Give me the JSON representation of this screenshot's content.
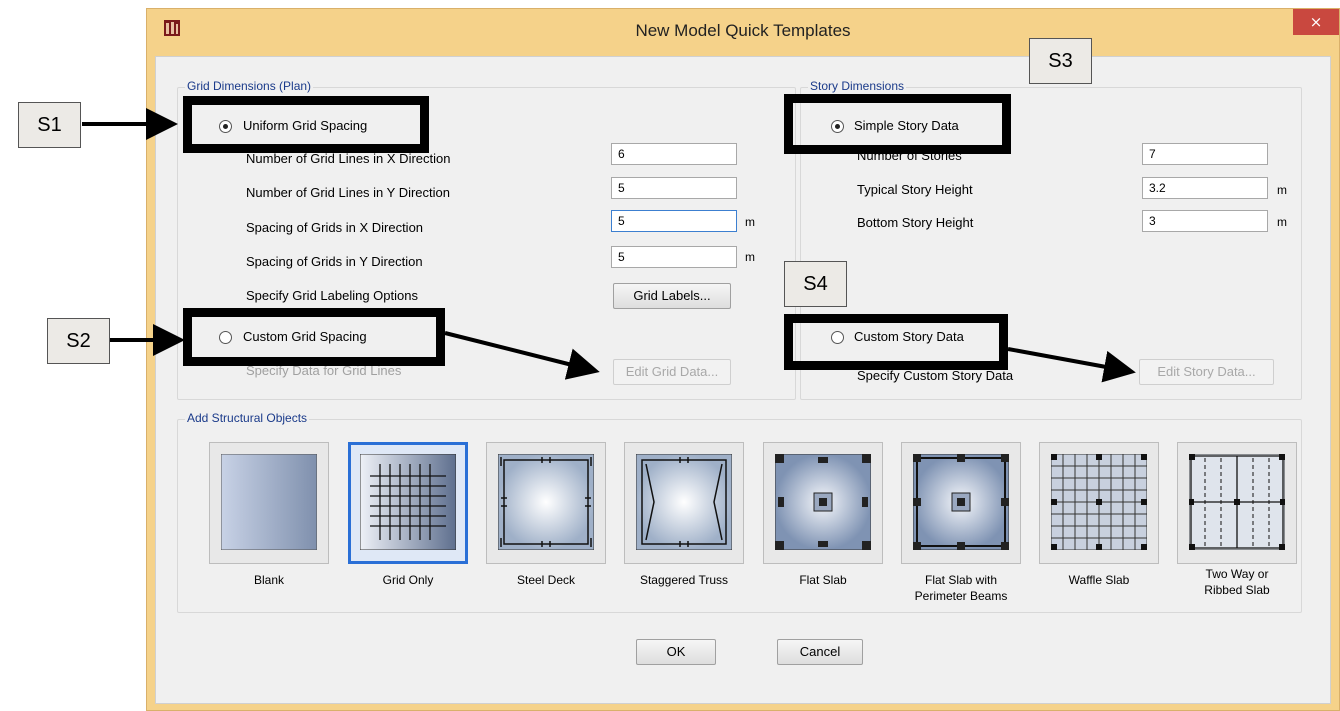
{
  "window": {
    "title": "New Model Quick Templates",
    "close_glyph": "×",
    "frame_color": "#f5d28a",
    "close_color": "#c9483f"
  },
  "grid_dimensions": {
    "title": "Grid Dimensions (Plan)",
    "uniform_label": "Uniform Grid Spacing",
    "uniform_selected": true,
    "fields": [
      {
        "label": "Number of Grid Lines in X Direction",
        "value": "6",
        "unit": ""
      },
      {
        "label": "Number of Grid Lines in Y Direction",
        "value": "5",
        "unit": ""
      },
      {
        "label": "Spacing of Grids in X Direction",
        "value": "5",
        "unit": "m"
      },
      {
        "label": "Spacing of Grids in Y Direction",
        "value": "5",
        "unit": "m"
      }
    ],
    "labeling_label": "Specify Grid Labeling Options",
    "grid_labels_button": "Grid Labels...",
    "custom_label": "Custom Grid Spacing",
    "custom_data_label": "Specify Data for Grid Lines",
    "edit_grid_button": "Edit Grid Data..."
  },
  "story_dimensions": {
    "title": "Story Dimensions",
    "simple_label": "Simple Story Data",
    "simple_selected": true,
    "fields": [
      {
        "label": "Number of Stories",
        "value": "7",
        "unit": ""
      },
      {
        "label": "Typical Story Height",
        "value": "3.2",
        "unit": "m"
      },
      {
        "label": "Bottom Story Height",
        "value": "3",
        "unit": "m"
      }
    ],
    "custom_label": "Custom Story Data",
    "custom_data_label": "Specify Custom Story Data",
    "edit_story_button": "Edit Story Data..."
  },
  "structural_objects": {
    "title": "Add Structural Objects",
    "templates": [
      {
        "label": "Blank",
        "icon": "blank-template-icon",
        "selected": false
      },
      {
        "label": "Grid Only",
        "icon": "grid-only-template-icon",
        "selected": true
      },
      {
        "label": "Steel Deck",
        "icon": "steel-deck-template-icon",
        "selected": false
      },
      {
        "label": "Staggered Truss",
        "icon": "staggered-truss-template-icon",
        "selected": false
      },
      {
        "label": "Flat Slab",
        "icon": "flat-slab-template-icon",
        "selected": false
      },
      {
        "label": "Flat Slab with\nPerimeter Beams",
        "line1": "Flat Slab with",
        "line2": "Perimeter Beams",
        "icon": "flat-slab-perimeter-beams-template-icon",
        "selected": false
      },
      {
        "label": "Waffle Slab",
        "icon": "waffle-slab-template-icon",
        "selected": false
      },
      {
        "label": "Two Way or\nRibbed Slab",
        "line1": "Two Way or",
        "line2": "Ribbed Slab",
        "icon": "two-way-ribbed-slab-template-icon",
        "selected": false
      }
    ]
  },
  "footer": {
    "ok": "OK",
    "cancel": "Cancel"
  },
  "annotations": {
    "s1": "S1",
    "s2": "S2",
    "s3": "S3",
    "s4": "S4"
  }
}
